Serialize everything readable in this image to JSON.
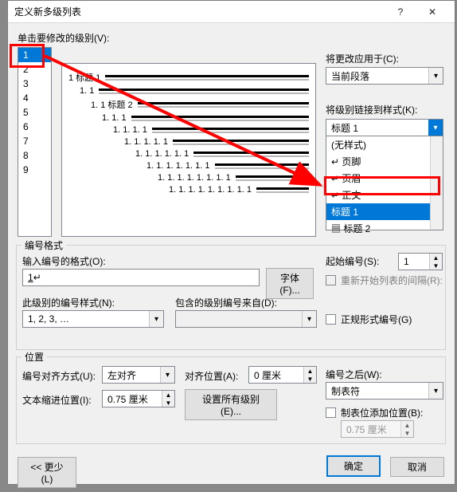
{
  "titlebar": {
    "title": "定义新多级列表"
  },
  "labels": {
    "click_level": "单击要修改的级别(V):",
    "apply_to": "将更改应用于(C):",
    "link_style": "将级别链接到样式(K):",
    "num_format_group": "编号格式",
    "enter_format": "输入编号的格式(O):",
    "font_btn": "字体(F)...",
    "start_at": "起始编号(S):",
    "restart_after": "重新开始列表的间隔(R):",
    "num_style": "此级别的编号样式(N):",
    "include_from": "包含的级别编号来自(D):",
    "legal": "正规形式编号(G)",
    "pos_group": "位置",
    "align": "编号对齐方式(U):",
    "align_at": "对齐位置(A):",
    "follow": "编号之后(W):",
    "indent_at": "文本缩进位置(I):",
    "set_all": "设置所有级别(E)...",
    "tab_add": "制表位添加位置(B):",
    "less": "<< 更少(L)",
    "ok": "确定",
    "cancel": "取消"
  },
  "levels": [
    "1",
    "2",
    "3",
    "4",
    "5",
    "6",
    "7",
    "8",
    "9"
  ],
  "selected_level_index": 0,
  "preview_rows": [
    {
      "indent": 0,
      "num": "1",
      "label": "标题 1"
    },
    {
      "indent": 1,
      "num": "1. 1"
    },
    {
      "indent": 2,
      "num": "1. 1",
      "label": "标题 2"
    },
    {
      "indent": 3,
      "num": "1. 1. 1"
    },
    {
      "indent": 4,
      "num": "1. 1. 1. 1"
    },
    {
      "indent": 5,
      "num": "1. 1. 1. 1. 1"
    },
    {
      "indent": 6,
      "num": "1. 1. 1. 1. 1. 1"
    },
    {
      "indent": 7,
      "num": "1. 1. 1. 1. 1. 1. 1"
    },
    {
      "indent": 8,
      "num": "1. 1. 1. 1. 1. 1. 1. 1"
    },
    {
      "indent": 9,
      "num": "1. 1. 1. 1. 1. 1. 1. 1. 1"
    }
  ],
  "apply_to_value": "当前段落",
  "link_style_value": "标题 1",
  "style_list": [
    {
      "text": "(无样式)"
    },
    {
      "text": "页脚",
      "prefix": "↵"
    },
    {
      "text": "页眉",
      "prefix": "↵"
    },
    {
      "text": "正文",
      "prefix": "↵"
    },
    {
      "text": "标题 1",
      "prefix": "",
      "selected": true
    },
    {
      "text": "标题 2",
      "prefix": "▦"
    }
  ],
  "number_format_value": "1",
  "start_at_value": "1",
  "num_style_value": "1, 2, 3, …",
  "align_value": "左对齐",
  "align_at_value": "0 厘米",
  "follow_value": "制表符",
  "indent_at_value": "0.75 厘米",
  "tab_pos_value": "0.75 厘米"
}
